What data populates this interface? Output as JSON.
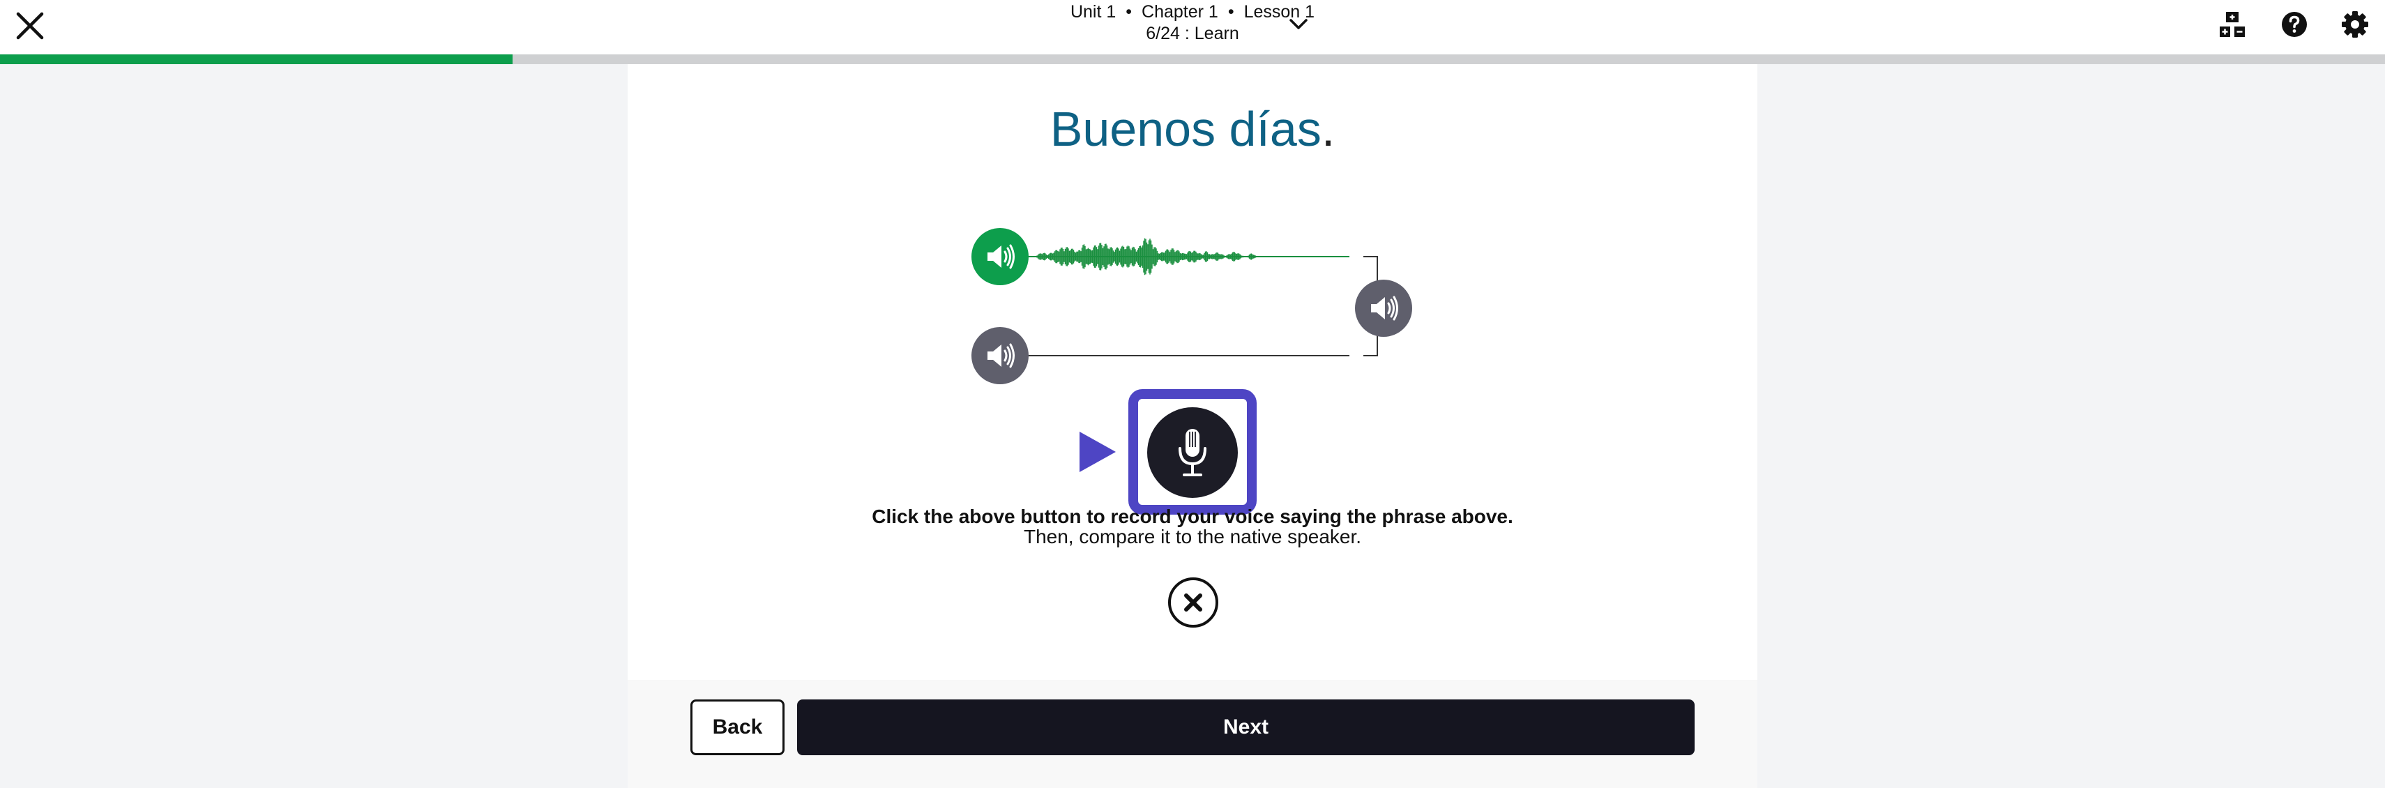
{
  "header": {
    "unit": "Unit 1",
    "chapter": "Chapter 1",
    "lesson": "Lesson 1",
    "separator": "•",
    "step": "6/24 : Learn",
    "icons": [
      "close-icon",
      "chevron-down-icon",
      "lesson-map-icon",
      "help-icon",
      "gear-icon"
    ]
  },
  "progress": {
    "fraction": 0.215
  },
  "lesson": {
    "phrase_main": "Buenos días",
    "phrase_punct": "."
  },
  "instructions": {
    "bold": "Click the above button to record your voice saying the phrase above.",
    "normal": "Then, compare it to the native speaker."
  },
  "footer": {
    "back_label": "Back",
    "next_label": "Next"
  },
  "colors": {
    "accent_green": "#0d9e4c",
    "phrase_blue": "#0e6184",
    "highlight_purple": "#4e45c4",
    "speaker_gray": "#5f5f6c",
    "button_dark": "#151520"
  }
}
